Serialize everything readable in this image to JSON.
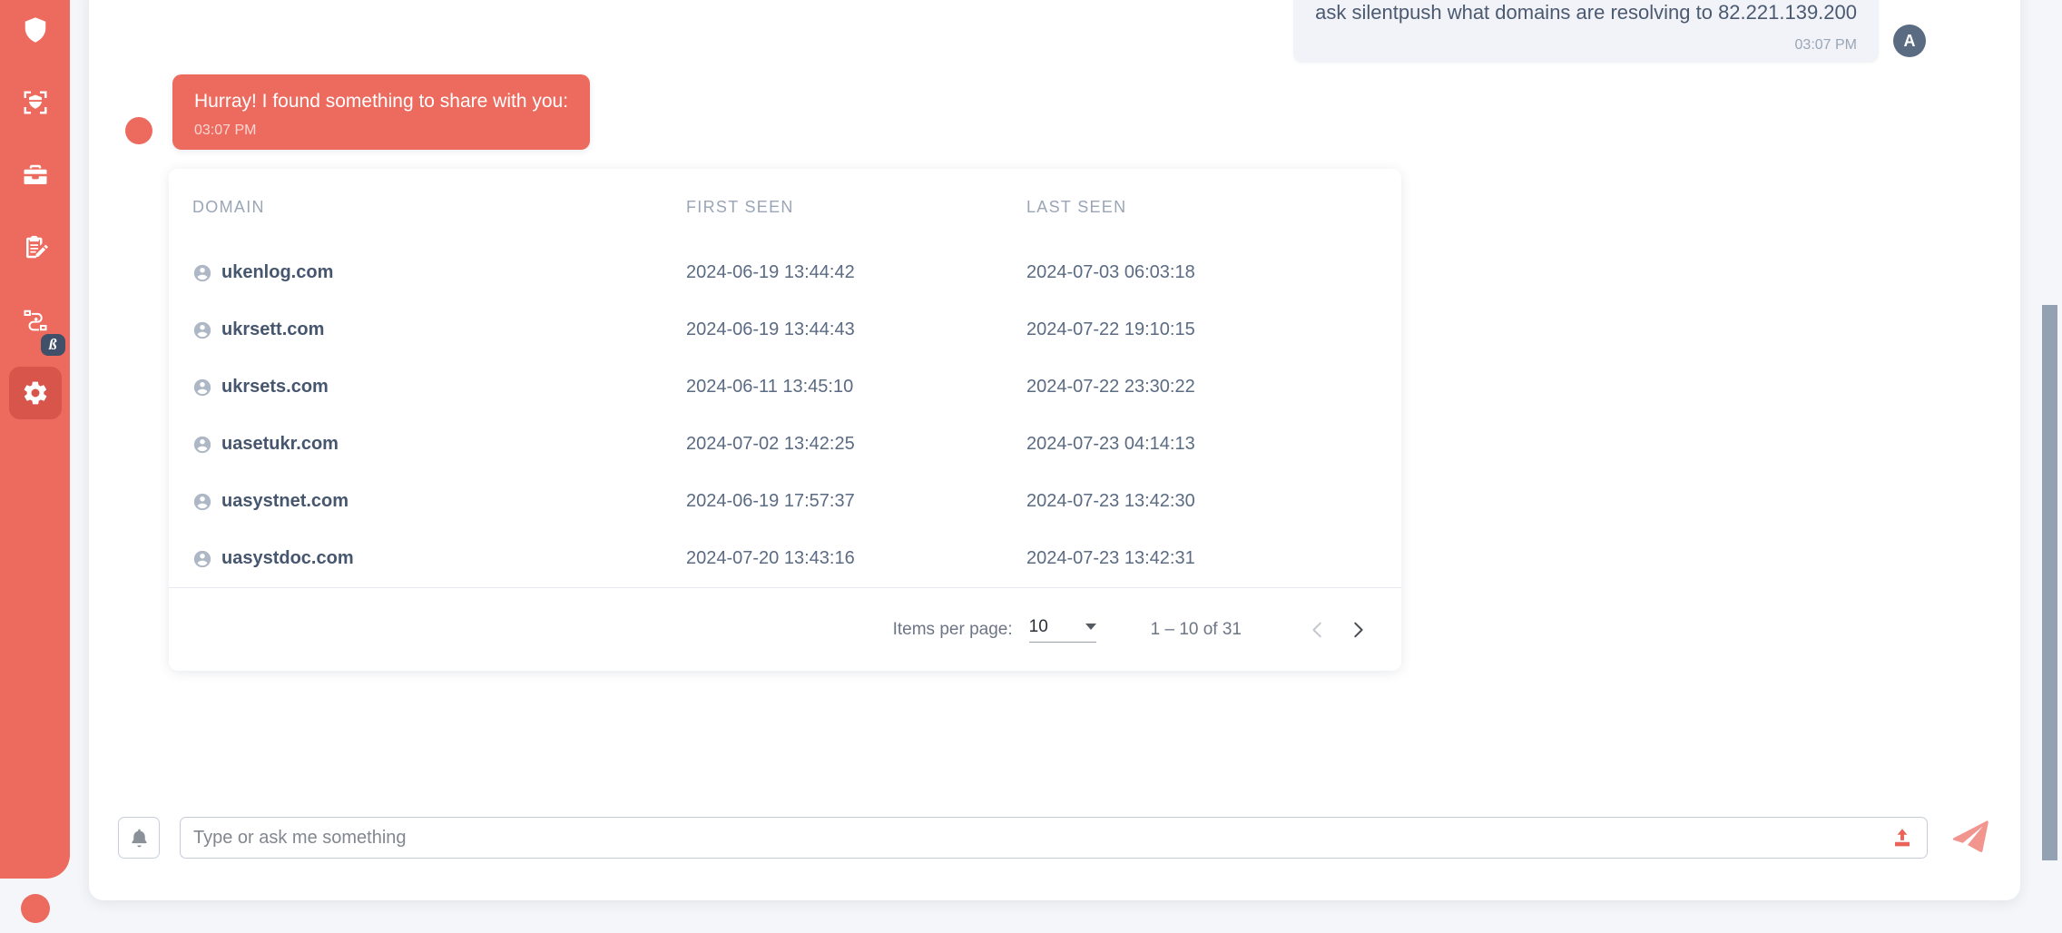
{
  "sidebar": {
    "items": [
      {
        "name": "brain-shield-icon",
        "label": "Threat Intelligence",
        "active": false,
        "badge": ""
      },
      {
        "name": "shield-scan-icon",
        "label": "Scan",
        "active": false,
        "badge": ""
      },
      {
        "name": "briefcase-icon",
        "label": "Cases",
        "active": false,
        "badge": ""
      },
      {
        "name": "clipboard-pen-icon",
        "label": "Reports",
        "active": false,
        "badge": ""
      },
      {
        "name": "workflow-icon",
        "label": "Workflows",
        "active": false,
        "badge": "ß"
      },
      {
        "name": "gear-icon",
        "label": "Settings",
        "active": true,
        "badge": ""
      }
    ]
  },
  "chat": {
    "user_message": {
      "text": "ask silentpush what domains are resolving to 82.221.139.200",
      "time": "03:07 PM",
      "avatar_initial": "A"
    },
    "bot_message": {
      "text": "Hurray! I found something to share with you:",
      "time": "03:07 PM"
    }
  },
  "result_table": {
    "columns": [
      "DOMAIN",
      "FIRST SEEN",
      "LAST SEEN"
    ],
    "rows": [
      {
        "domain": "ukenlog.com",
        "first_seen": "2024-06-19 13:44:42",
        "last_seen": "2024-07-03 06:03:18"
      },
      {
        "domain": "ukrsett.com",
        "first_seen": "2024-06-19 13:44:43",
        "last_seen": "2024-07-22 19:10:15"
      },
      {
        "domain": "ukrsets.com",
        "first_seen": "2024-06-11 13:45:10",
        "last_seen": "2024-07-22 23:30:22"
      },
      {
        "domain": "uasetukr.com",
        "first_seen": "2024-07-02 13:42:25",
        "last_seen": "2024-07-23 04:14:13"
      },
      {
        "domain": "uasystnet.com",
        "first_seen": "2024-06-19 17:57:37",
        "last_seen": "2024-07-23 13:42:30"
      },
      {
        "domain": "uasystdoc.com",
        "first_seen": "2024-07-20 13:43:16",
        "last_seen": "2024-07-23 13:42:31"
      }
    ]
  },
  "paginator": {
    "items_per_page_label": "Items per page:",
    "items_per_page_value": "10",
    "range_label": "1 – 10 of 31"
  },
  "composer": {
    "placeholder": "Type or ask me something",
    "value": ""
  },
  "colors": {
    "brand_red": "#ed6a5e",
    "rail_active": "#d8554b",
    "badge_navy": "#3f5068",
    "user_bubble": "#f1f3f8",
    "text_navy": "#45566e",
    "scrollbar": "#94a1b2"
  }
}
